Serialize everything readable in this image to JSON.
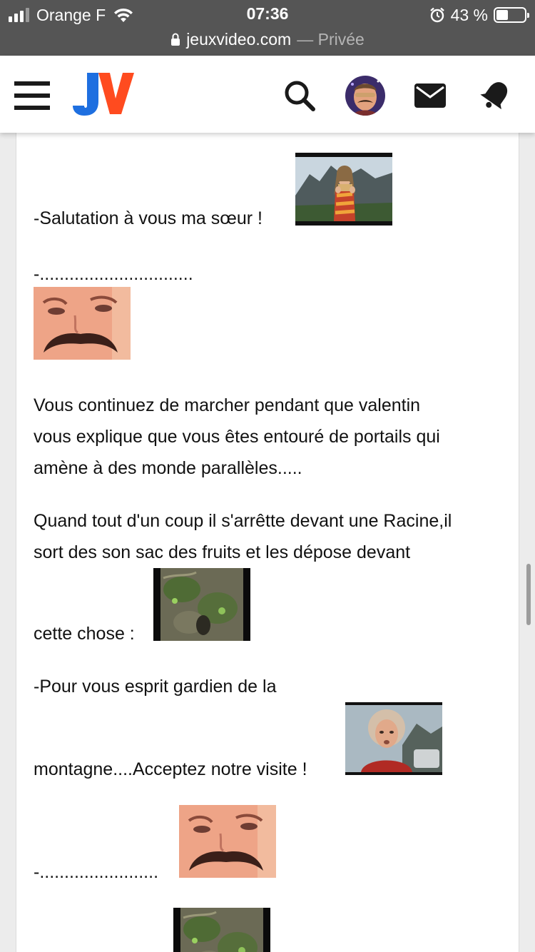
{
  "status_bar": {
    "carrier": "Orange F",
    "time": "07:36",
    "battery_percent": "43 %",
    "battery_level": 0.43,
    "url": "jeuxvideo.com",
    "url_suffix": "— Privée"
  },
  "header": {
    "logo_text": "JV",
    "logo_colors": {
      "j": "#1e6fe0",
      "v": "#ff4b1f"
    },
    "icons": [
      "menu-icon",
      "search-icon",
      "avatar",
      "mail-icon",
      "bell-icon"
    ]
  },
  "post": {
    "lines": [
      "-Salutation à vous ma sœur !",
      "-...............................",
      "Vous continuez de marcher pendant que valentin",
      "vous explique que vous êtes entouré de portails qui",
      "amène à des monde parallèles.....",
      "Quand tout d'un coup il s'arrêtte devant une Racine,il",
      "sort des son sac des fruits et les dépose devant",
      "cette chose :",
      "-Pour vous esprit gardien de la",
      "montagne....Acceptez notre visite !",
      "-........................"
    ],
    "stickers": [
      "flute-player-sticker",
      "mustache-face-sticker",
      "mossy-rock-sticker",
      "curly-hair-man-sticker",
      "mustache-face-sticker",
      "mossy-rock-sticker"
    ]
  },
  "colors": {
    "status_bar_bg": "#555555",
    "header_bg": "#ffffff",
    "page_bg": "#ececec",
    "text": "#111111"
  }
}
